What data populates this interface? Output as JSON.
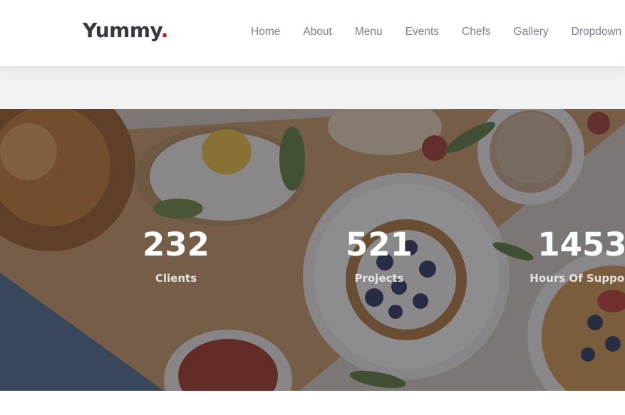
{
  "header": {
    "logo_text": "Yummy",
    "logo_dot": ".",
    "nav": [
      "Home",
      "About",
      "Menu",
      "Events",
      "Chefs",
      "Gallery",
      "Dropdown"
    ]
  },
  "stats": [
    {
      "number": "232",
      "label": "Clients"
    },
    {
      "number": "521",
      "label": "Projects"
    },
    {
      "number": "1453",
      "label": "Hours Of Support"
    }
  ],
  "colors": {
    "accent": "#ce1212",
    "logo_text": "#37373f",
    "nav_text": "#7f7f90",
    "band": "#f2f2f2"
  }
}
